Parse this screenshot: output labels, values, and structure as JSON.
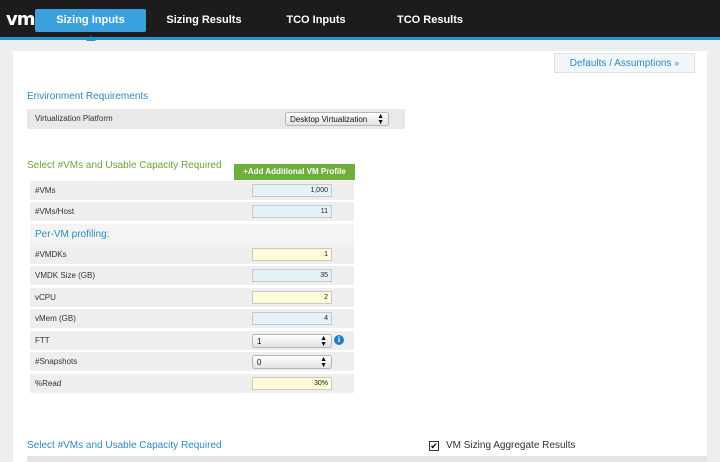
{
  "nav": {
    "logo": "vm",
    "tabs": [
      {
        "label": "Sizing Inputs",
        "active": true
      },
      {
        "label": "Sizing Results",
        "active": false
      },
      {
        "label": "TCO Inputs",
        "active": false
      },
      {
        "label": "TCO Results",
        "active": false
      }
    ]
  },
  "defaults_tab": {
    "label": "Defaults / Assumptions",
    "icon": "double-chevron-up-icon"
  },
  "environment": {
    "title": "Environment Requirements",
    "platform_label": "Virtualization Platform",
    "platform_value": "Desktop Virtualization"
  },
  "vm_section": {
    "title": "Select #VMs and Usable Capacity Required",
    "add_button": "+Add Additional VM Profile",
    "vms_label": "#VMs",
    "vms_value": "1,000",
    "vms_per_host_label": "#VMs/Host",
    "vms_per_host_value": "11",
    "per_vm_title": "Per-VM profiling:",
    "vmdks_label": "#VMDKs",
    "vmdks_value": "1",
    "vmdk_size_label": "VMDK Size (GB)",
    "vmdk_size_value": "35",
    "vcpu_label": "vCPU",
    "vcpu_value": "2",
    "vmem_label": "vMem (GB)",
    "vmem_value": "4",
    "ftt_label": "FTT",
    "ftt_value": "1",
    "snapshots_label": "#Snapshots",
    "snapshots_value": "0",
    "read_label": "%Read",
    "read_value": "30%"
  },
  "bottom_section": {
    "title": "Select #VMs and Usable Capacity Required",
    "checkbox_label": "VM Sizing Aggregate Results",
    "checkbox_checked": true
  },
  "colors": {
    "nav_bg": "#1c1c1c",
    "accent": "#1f94d2",
    "link_blue": "#2b8bc6",
    "green": "#6daf3a"
  }
}
